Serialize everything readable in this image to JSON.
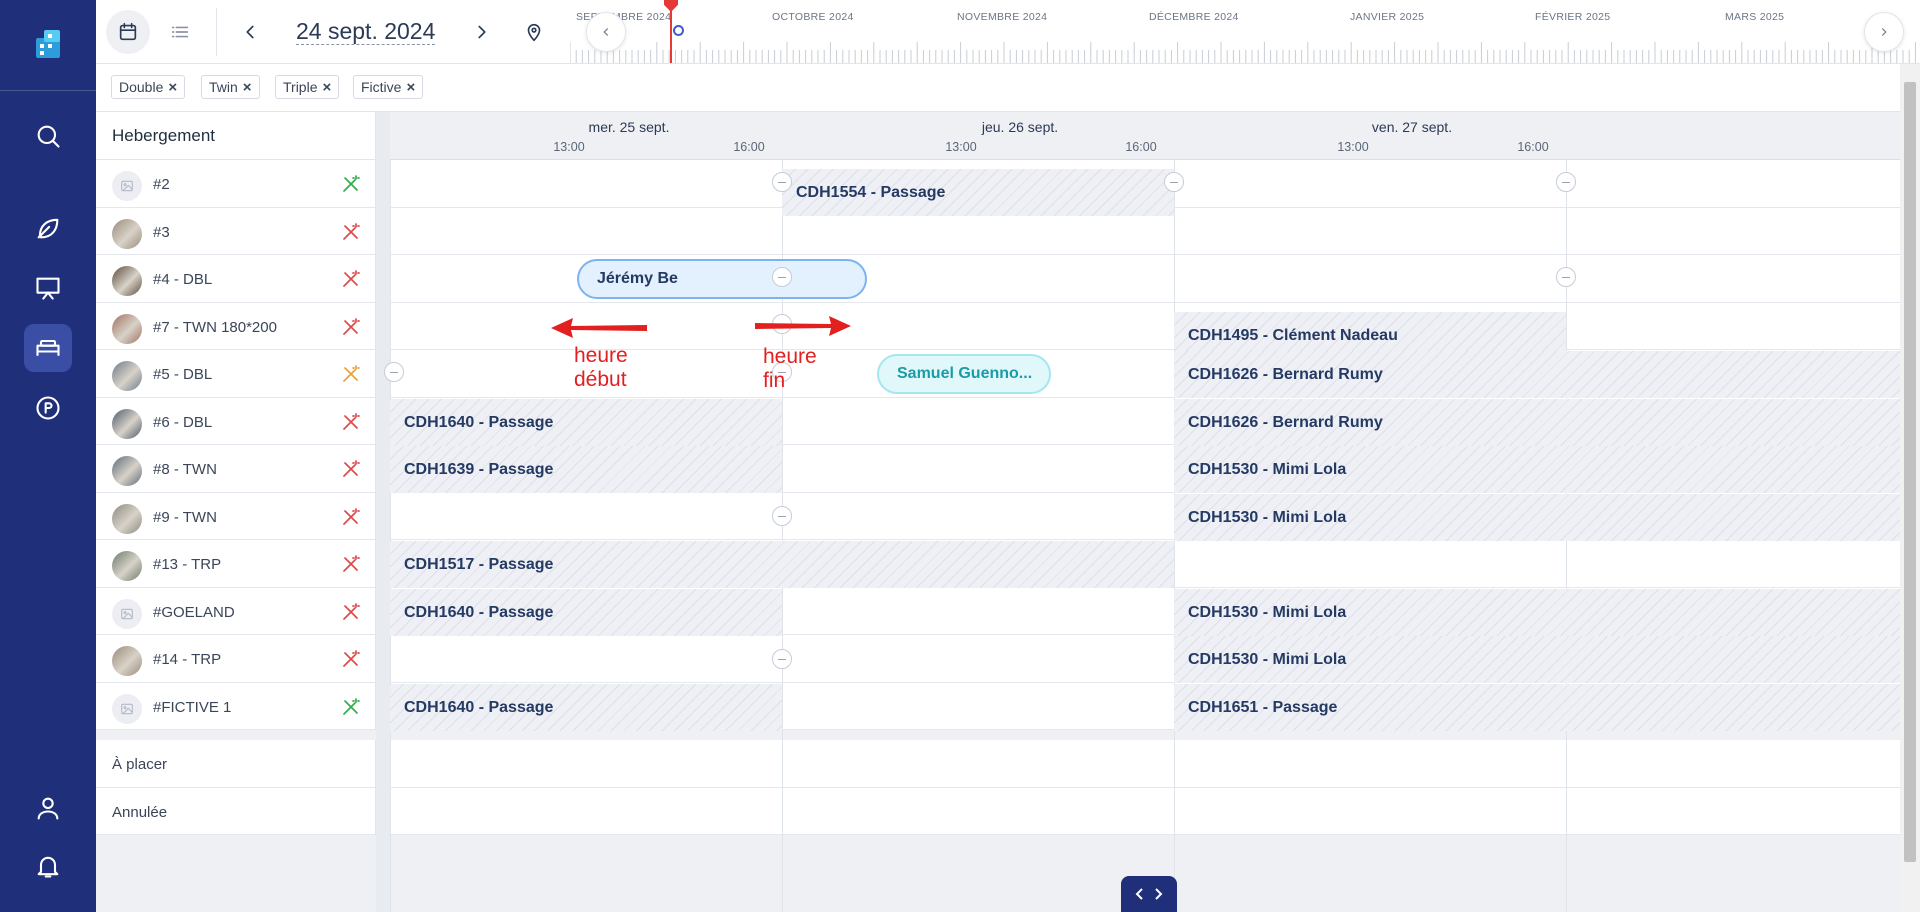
{
  "toolbar": {
    "date": "24 sept. 2024"
  },
  "overview": {
    "months": [
      "SEPTEMBRE 2024",
      "OCTOBRE 2024",
      "NOVEMBRE 2024",
      "DÉCEMBRE 2024",
      "JANVIER 2025",
      "FÉVRIER 2025",
      "MARS 2025"
    ]
  },
  "filters": [
    "Double",
    "Twin",
    "Triple",
    "Fictive"
  ],
  "planning": {
    "resource_header": "Hebergement",
    "days": [
      "mer. 25 sept.",
      "jeu. 26 sept.",
      "ven. 27 sept."
    ],
    "hours": [
      "13:00",
      "16:00"
    ],
    "rows": [
      {
        "name": "#2",
        "wand": "#2fae4a"
      },
      {
        "name": "#3",
        "wand": "#e04848"
      },
      {
        "name": "#4 - DBL",
        "wand": "#e04848"
      },
      {
        "name": "#7 - TWN 180*200",
        "wand": "#e04848"
      },
      {
        "name": "#5 - DBL",
        "wand": "#e8a23a"
      },
      {
        "name": "#6 - DBL",
        "wand": "#e04848"
      },
      {
        "name": "#8 - TWN",
        "wand": "#e04848"
      },
      {
        "name": "#9 - TWN",
        "wand": "#e04848"
      },
      {
        "name": "#13 - TRP",
        "wand": "#e04848"
      },
      {
        "name": "#GOELAND",
        "wand": "#e04848"
      },
      {
        "name": "#14 - TRP",
        "wand": "#e04848"
      },
      {
        "name": "#FICTIVE 1",
        "wand": "#2fae4a"
      }
    ],
    "extra_rows": [
      "À placer",
      "Annulée"
    ],
    "bookings": {
      "b_3_1": "CDH1554 - Passage",
      "b_4_1": "Jérémy Be",
      "b_7_1": "CDH1495 - Clément Nadeau",
      "b_5_1": "Samuel Guenno...",
      "b_5_2": "CDH1626 - Bernard Rumy",
      "b_6_1": "CDH1640 - Passage",
      "b_6_2": "CDH1626 - Bernard Rumy",
      "b_8_1": "CDH1639 - Passage",
      "b_8_2": "CDH1530 - Mimi Lola",
      "b_9_2": "CDH1530 - Mimi Lola",
      "b_13_1": "CDH1517 - Passage",
      "b_goe_1": "CDH1640 - Passage",
      "b_goe_2": "CDH1530 - Mimi Lola",
      "b_14_2": "CDH1530 - Mimi Lola",
      "b_f1_1": "CDH1640 - Passage",
      "b_f1_2": "CDH1651 - Passage"
    }
  },
  "annotations": {
    "start": "heure\ndébut",
    "end": "heure\nfin"
  },
  "colors": {
    "nav": "#1f2f7a",
    "accent_red": "#e53935"
  }
}
